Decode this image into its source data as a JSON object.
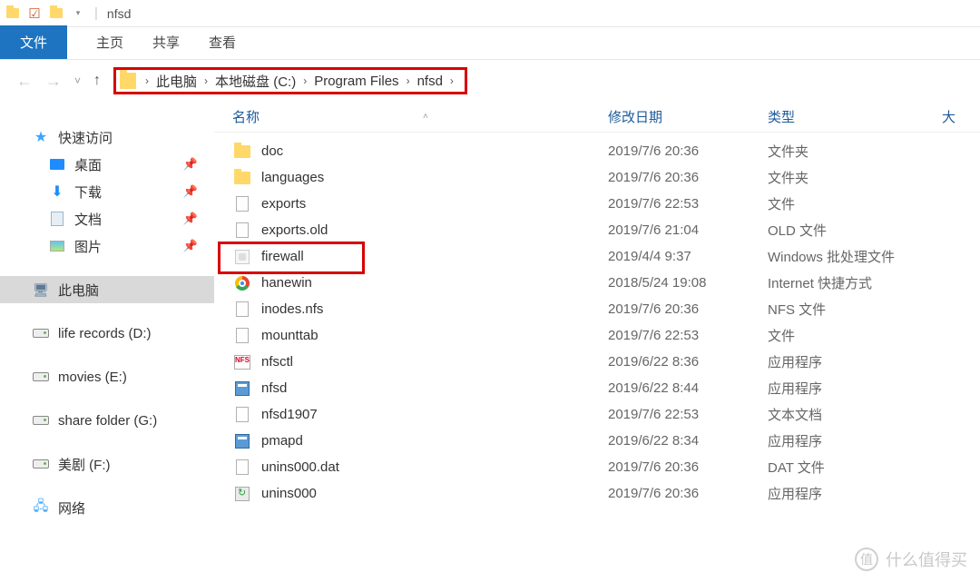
{
  "titlebar": {
    "title": "nfsd"
  },
  "tabs": {
    "file": "文件",
    "home": "主页",
    "share": "共享",
    "view": "查看"
  },
  "breadcrumb": {
    "segments": [
      "此电脑",
      "本地磁盘 (C:)",
      "Program Files",
      "nfsd"
    ]
  },
  "columns": {
    "name": "名称",
    "date": "修改日期",
    "type": "类型",
    "size": "大"
  },
  "sidebar": {
    "quick": "快速访问",
    "desktop": "桌面",
    "downloads": "下载",
    "documents": "文档",
    "pictures": "图片",
    "thispc": "此电脑",
    "drives": [
      "life records (D:)",
      "movies (E:)",
      "share folder (G:)",
      "美剧 (F:)"
    ],
    "network": "网络"
  },
  "files": [
    {
      "icon": "folder",
      "name": "doc",
      "date": "2019/7/6 20:36",
      "type": "文件夹"
    },
    {
      "icon": "folder",
      "name": "languages",
      "date": "2019/7/6 20:36",
      "type": "文件夹"
    },
    {
      "icon": "file",
      "name": "exports",
      "date": "2019/7/6 22:53",
      "type": "文件"
    },
    {
      "icon": "file",
      "name": "exports.old",
      "date": "2019/7/6 21:04",
      "type": "OLD 文件"
    },
    {
      "icon": "bat",
      "name": "firewall",
      "date": "2019/4/4 9:37",
      "type": "Windows 批处理文件",
      "highlight": true
    },
    {
      "icon": "chrome",
      "name": "hanewin",
      "date": "2018/5/24 19:08",
      "type": "Internet 快捷方式"
    },
    {
      "icon": "file",
      "name": "inodes.nfs",
      "date": "2019/7/6 20:36",
      "type": "NFS 文件"
    },
    {
      "icon": "file",
      "name": "mounttab",
      "date": "2019/7/6 22:53",
      "type": "文件"
    },
    {
      "icon": "nfs",
      "name": "nfsctl",
      "date": "2019/6/22 8:36",
      "type": "应用程序"
    },
    {
      "icon": "exe",
      "name": "nfsd",
      "date": "2019/6/22 8:44",
      "type": "应用程序"
    },
    {
      "icon": "file",
      "name": "nfsd1907",
      "date": "2019/7/6 22:53",
      "type": "文本文档"
    },
    {
      "icon": "exe",
      "name": "pmapd",
      "date": "2019/6/22 8:34",
      "type": "应用程序"
    },
    {
      "icon": "file",
      "name": "unins000.dat",
      "date": "2019/7/6 20:36",
      "type": "DAT 文件"
    },
    {
      "icon": "unins",
      "name": "unins000",
      "date": "2019/7/6 20:36",
      "type": "应用程序"
    }
  ],
  "watermark": {
    "badge": "值",
    "text": "什么值得买"
  }
}
